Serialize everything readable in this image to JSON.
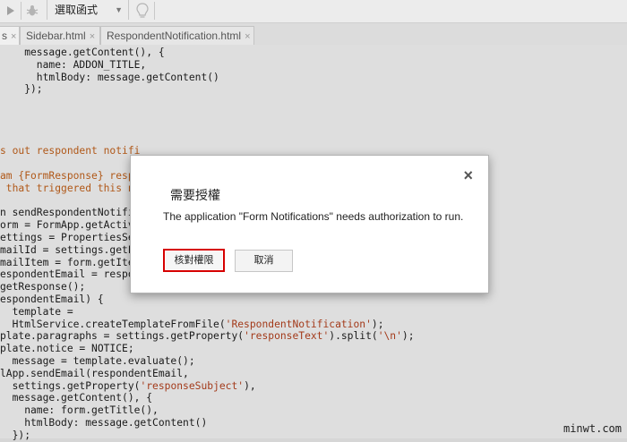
{
  "toolbar": {
    "run_icon": "play-icon",
    "debug_icon": "bug-icon",
    "function_select": "選取函式",
    "lightbulb_icon": "lightbulb-icon"
  },
  "tabs": [
    {
      "label": "s",
      "close": "×"
    },
    {
      "label": "Sidebar.html",
      "close": "×"
    },
    {
      "label": "RespondentNotification.html",
      "close": "×"
    }
  ],
  "code_lines": [
    "    message.getContent(), {",
    "      name: ADDON_TITLE,",
    "      htmlBody: message.getContent()",
    "    });",
    "",
    "",
    "",
    "",
    "s out respondent notifi",
    "",
    "am {FormResponse} respo",
    " that triggered this no",
    "",
    "n sendRespondentNotific",
    "orm = FormApp.getActive",
    "ettings = PropertiesSer",
    "mailId = settings.getPr",
    "mailItem = form.getItem",
    "espondentEmail = respon",
    "getResponse();",
    "espondentEmail) {",
    "  template =",
    "  HtmlService.createTemplateFromFile('RespondentNotification');",
    "plate.paragraphs = settings.getProperty('responseText').split('\\n');",
    "plate.notice = NOTICE;",
    "  message = template.evaluate();",
    "lApp.sendEmail(respondentEmail,",
    "  settings.getProperty('responseSubject'),",
    "  message.getContent(), {",
    "    name: form.getTitle(),",
    "    htmlBody: message.getContent()",
    "  });"
  ],
  "dialog": {
    "title": "需要授權",
    "message": "The application \"Form Notifications\" needs authorization to run.",
    "close": "×",
    "authorize_label": "核對權限",
    "cancel_label": "取消"
  },
  "watermark": "minwt.com"
}
